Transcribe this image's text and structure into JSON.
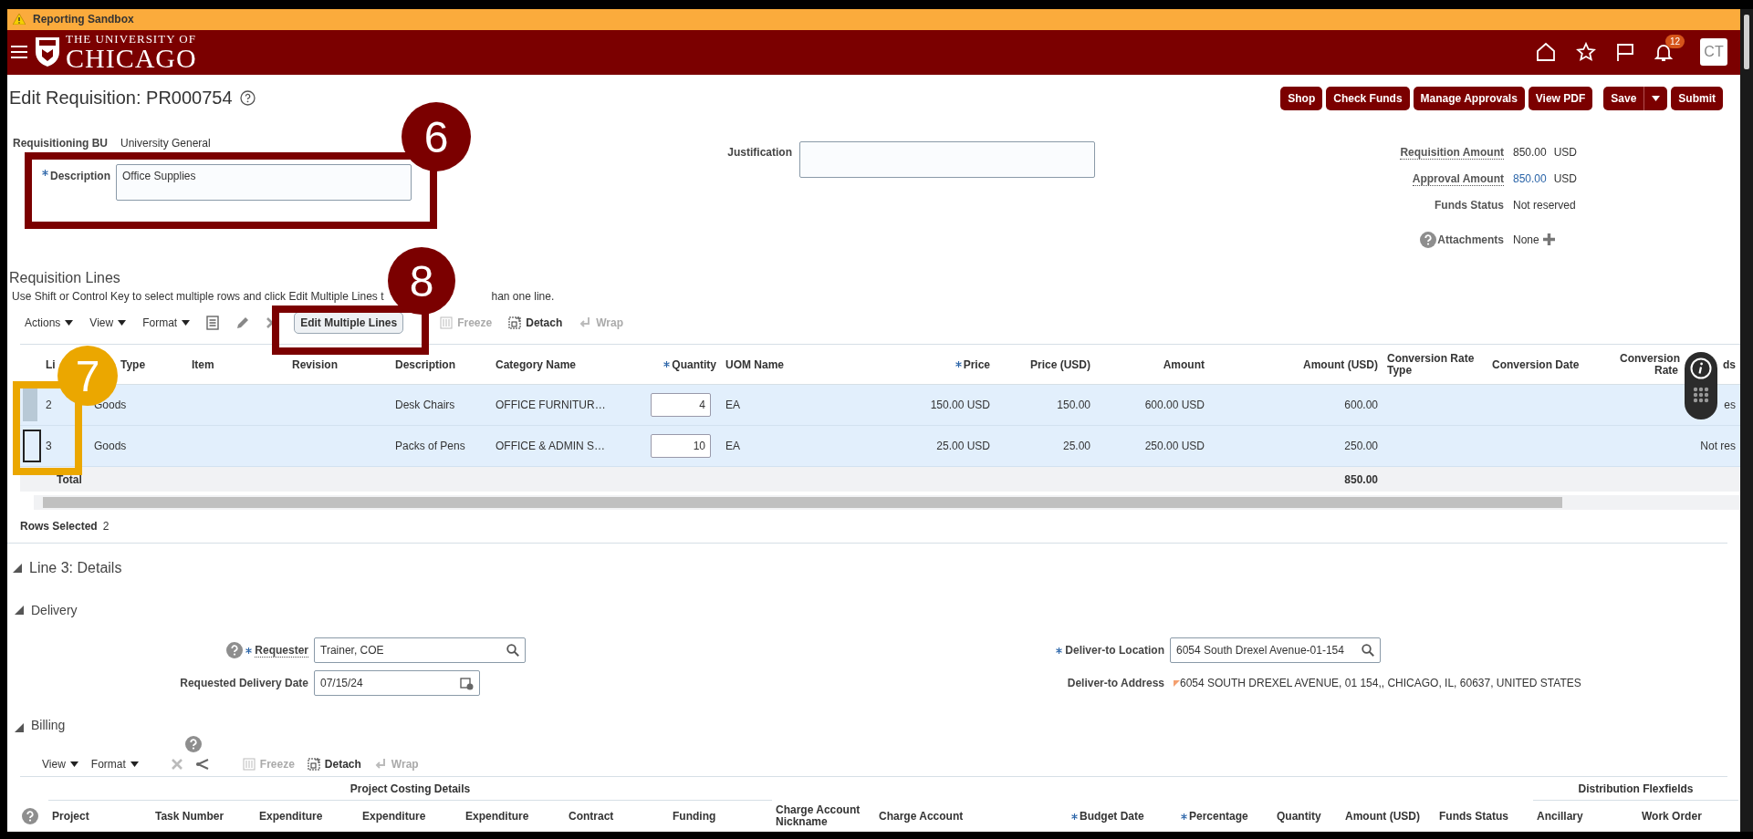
{
  "sandbox_bar": {
    "label": "Reporting Sandbox"
  },
  "header": {
    "logo_line1": "THE UNIVERSITY OF",
    "logo_line2": "CHICAGO",
    "notification_count": "12",
    "avatar": "CT"
  },
  "title": "Edit Requisition: PR000754",
  "actions": [
    {
      "label": "Shop",
      "kind": "plain"
    },
    {
      "label": "Check Funds",
      "kind": "plain"
    },
    {
      "label": "Manage Approvals",
      "kind": "plain"
    },
    {
      "label": "View PDF",
      "kind": "plain"
    },
    {
      "label": "Save",
      "kind": "split"
    },
    {
      "label": "Submit",
      "kind": "plain"
    }
  ],
  "form": {
    "requisitioning_bu": {
      "label": "Requisitioning BU",
      "value": "University General"
    },
    "description": {
      "label": "Description",
      "required": true,
      "value": "Office Supplies"
    },
    "justification": {
      "label": "Justification"
    },
    "summary": [
      {
        "label": "Requisition Amount",
        "hint": true,
        "value": "850.00",
        "link": false,
        "currency": "USD"
      },
      {
        "label": "Approval Amount",
        "hint": true,
        "value": "850.00",
        "link": true,
        "currency": "USD"
      },
      {
        "label": "Funds Status",
        "hint": false,
        "value": "Not reserved",
        "link": false
      }
    ],
    "attachments": {
      "label": "Attachments",
      "value": "None"
    }
  },
  "lines": {
    "title": "Requisition Lines",
    "hint_parts": [
      "Use Shift or Control Key to select multiple rows and click Edit Multiple Lines t",
      "han one line."
    ],
    "menus": [
      "Actions",
      "View",
      "Format"
    ],
    "edit_multiple": "Edit Multiple Lines",
    "tools": [
      {
        "label": "Freeze",
        "disabled": true
      },
      {
        "label": "Detach",
        "disabled": false
      },
      {
        "label": "Wrap",
        "disabled": true
      }
    ],
    "columns": [
      {
        "label": "Li",
        "kind": "text"
      },
      {
        "label": "Type",
        "kind": "text"
      },
      {
        "label": "Item",
        "kind": "text"
      },
      {
        "label": "Revision",
        "kind": "text"
      },
      {
        "label": "Description",
        "kind": "text"
      },
      {
        "label": "Category Name",
        "kind": "text"
      },
      {
        "label": "Quantity",
        "kind": "input",
        "required": true
      },
      {
        "label": "UOM Name",
        "kind": "text"
      },
      {
        "label": "Price",
        "kind": "number",
        "required": true
      },
      {
        "label": "Price (USD)",
        "kind": "number"
      },
      {
        "label": "Amount",
        "kind": "number"
      },
      {
        "label": "Amount (USD)",
        "kind": "number"
      },
      {
        "label": "Conversion Rate Type",
        "kind": "text"
      },
      {
        "label": "Conversion Date",
        "kind": "text"
      },
      {
        "label": "Conversion Rate",
        "kind": "number"
      },
      {
        "label": "ds",
        "kind": "number"
      }
    ],
    "rows": [
      {
        "selected": true,
        "current": false,
        "cells": [
          "2",
          "Goods",
          null,
          null,
          "Desk Chairs",
          "OFFICE FURNITUR…",
          "4",
          "EA",
          "150.00 USD",
          "150.00",
          "600.00 USD",
          "600.00",
          null,
          null,
          null,
          "es"
        ]
      },
      {
        "selected": true,
        "current": true,
        "cells": [
          "3",
          "Goods",
          null,
          null,
          "Packs of Pens",
          "OFFICE & ADMIN S…",
          "10",
          "EA",
          "25.00 USD",
          "25.00",
          "250.00 USD",
          "250.00",
          null,
          null,
          null,
          "Not res"
        ]
      }
    ],
    "total": {
      "label": "Total",
      "value": "850.00"
    },
    "rows_selected": {
      "label": "Rows Selected",
      "value": "2"
    }
  },
  "details": {
    "title": "Line 3: Details",
    "delivery": {
      "title": "Delivery",
      "expanded": true,
      "requester": {
        "label": "Requester",
        "required": true,
        "value": "Trainer, COE"
      },
      "delivery_date": {
        "label": "Requested Delivery Date",
        "value": "07/15/24"
      },
      "location": {
        "label": "Deliver-to Location",
        "required": true,
        "value": "6054 South Drexel Avenue-01-154"
      },
      "address": {
        "label": "Deliver-to Address",
        "value": "6054 SOUTH DREXEL AVENUE, 01 154,, CHICAGO, IL, 60637, UNITED STATES"
      }
    },
    "billing": {
      "title": "Billing",
      "expanded": true,
      "menus": [
        "View",
        "Format"
      ],
      "tools": [
        {
          "label": "Freeze",
          "disabled": true
        },
        {
          "label": "Detach",
          "disabled": false
        },
        {
          "label": "Wrap",
          "disabled": true
        }
      ],
      "groups": [
        "Project Costing Details",
        "Distribution Flexfields"
      ],
      "columns": [
        {
          "label": "Project"
        },
        {
          "label": "Task Number"
        },
        {
          "label": "Expenditure"
        },
        {
          "label": "Expenditure"
        },
        {
          "label": "Expenditure"
        },
        {
          "label": "Contract"
        },
        {
          "label": "Funding"
        },
        {
          "label": "Charge Account Nickname"
        },
        {
          "label": "Charge Account"
        },
        {
          "label": "Budget Date",
          "required": true
        },
        {
          "label": "Percentage",
          "required": true
        },
        {
          "label": "Quantity"
        },
        {
          "label": "Amount (USD)"
        },
        {
          "label": "Funds Status"
        },
        {
          "label": "Ancillary"
        },
        {
          "label": "Work Order"
        }
      ]
    }
  },
  "callouts": [
    {
      "number": "6",
      "color": "#7b0000"
    },
    {
      "number": "7",
      "color": "#eba700"
    },
    {
      "number": "8",
      "color": "#7b0000"
    }
  ]
}
